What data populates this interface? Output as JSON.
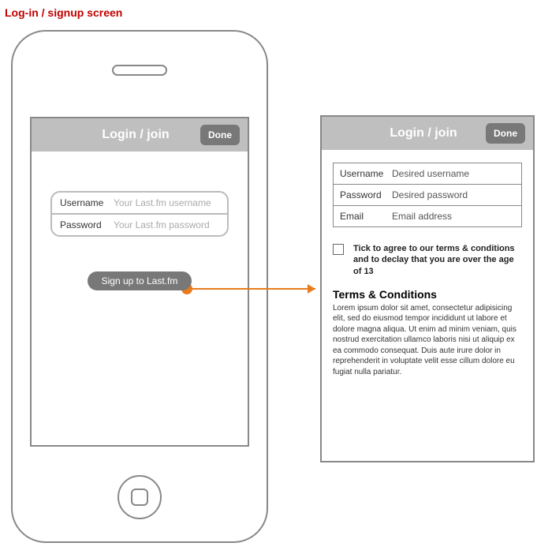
{
  "page_title": "Log-in / signup screen",
  "login": {
    "header_title": "Login / join",
    "done_label": "Done",
    "username_label": "Username",
    "username_placeholder": "Your Last.fm username",
    "password_label": "Password",
    "password_placeholder": "Your Last.fm password",
    "signup_label": "Sign up to Last.fm"
  },
  "signup": {
    "header_title": "Login / join",
    "done_label": "Done",
    "username_label": "Username",
    "username_placeholder": "Desired username",
    "password_label": "Password",
    "password_placeholder": "Desired password",
    "email_label": "Email",
    "email_placeholder": "Email address",
    "checkbox_text": "Tick to agree to our terms & conditions and to declay that you are over the age of 13",
    "terms_heading": "Terms & Conditions",
    "terms_body": "Lorem ipsum dolor sit amet, consectetur adipisicing elit, sed do eiusmod tempor incididunt ut labore et dolore magna aliqua. Ut enim ad minim veniam, quis nostrud exercitation ullamco laboris nisi ut aliquip ex ea commodo consequat. Duis aute irure dolor in reprehenderit in voluptate velit esse cillum dolore eu fugiat nulla pariatur."
  }
}
